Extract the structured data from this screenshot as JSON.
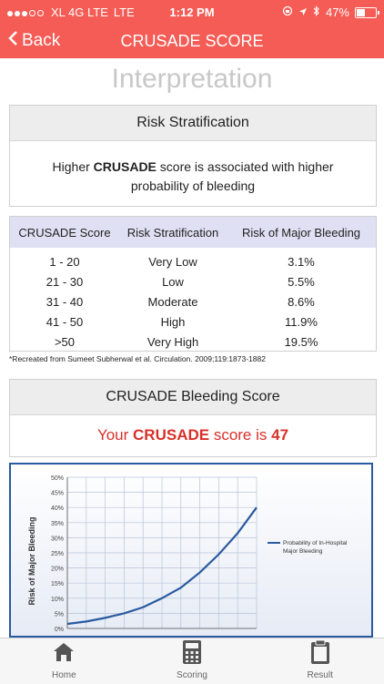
{
  "status_bar": {
    "carrier": "XL 4G LTE",
    "network": "LTE",
    "time": "1:12 PM",
    "battery": "47%",
    "battery_level": 0.47,
    "icons": [
      "signal-dots-icon",
      "location-arrow-icon",
      "bluetooth-icon",
      "battery-icon",
      "lock-rotation-icon"
    ]
  },
  "nav": {
    "back_label": "Back",
    "title": "CRUSADE SCORE"
  },
  "section_heading": "Interpretation",
  "risk_card": {
    "title": "Risk Stratification",
    "text_before": "Higher ",
    "text_bold": "CRUSADE",
    "text_after": " score is associated with higher probability of bleeding"
  },
  "table": {
    "headers": [
      "CRUSADE Score",
      "Risk Stratification",
      "Risk of Major Bleeding"
    ],
    "rows": [
      [
        "1 - 20",
        "Very Low",
        "3.1%"
      ],
      [
        "21 - 30",
        "Low",
        "5.5%"
      ],
      [
        "31 - 40",
        "Moderate",
        "8.6%"
      ],
      [
        "41 - 50",
        "High",
        "11.9%"
      ],
      [
        ">50",
        "Very High",
        "19.5%"
      ]
    ]
  },
  "footnote": "*Recreated from Sumeet Subherwal et al. Circulation. 2009;119:1873-1882",
  "score_card": {
    "title": "CRUSADE Bleeding Score",
    "prefix": "Your ",
    "bold": "CRUSADE",
    "middle": " score is ",
    "value": "47"
  },
  "chart_data": {
    "type": "line",
    "ylabel": "Risk of Major Bleeding",
    "xlabel": "",
    "yticks": [
      "0%",
      "5%",
      "10%",
      "15%",
      "20%",
      "25%",
      "30%",
      "35%",
      "40%",
      "45%",
      "50%"
    ],
    "ylim": [
      0,
      50
    ],
    "xlim": [
      0,
      100
    ],
    "legend": "Probability of In-Hospital Major Bleeding",
    "legend_position": "right",
    "grid": true,
    "accent_color": "#2a5aa0",
    "series": [
      {
        "name": "Probability of In-Hospital Major Bleeding",
        "x": [
          0,
          10,
          20,
          30,
          40,
          50,
          60,
          70,
          80,
          90,
          100
        ],
        "values": [
          1.5,
          2.3,
          3.5,
          5.0,
          7.0,
          10.0,
          13.5,
          18.5,
          24.5,
          31.5,
          40.0
        ]
      }
    ]
  },
  "tabs": [
    {
      "label": "Home",
      "icon": "home-icon"
    },
    {
      "label": "Scoring",
      "icon": "calculator-icon"
    },
    {
      "label": "Result",
      "icon": "clipboard-icon"
    }
  ]
}
